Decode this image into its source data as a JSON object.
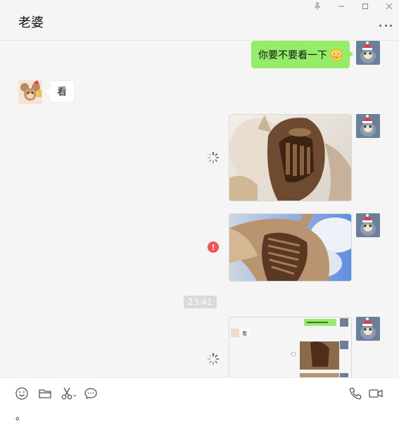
{
  "window": {
    "title": "老婆",
    "controls": [
      "pin-icon",
      "minimize-icon",
      "maximize-icon",
      "close-icon"
    ]
  },
  "messages": [
    {
      "sender": "me",
      "type": "text",
      "text": "你要不要看一下",
      "emoji": "flushed-face-icon"
    },
    {
      "sender": "contact",
      "type": "text",
      "text": "看"
    },
    {
      "sender": "me",
      "type": "image",
      "status": "sending"
    },
    {
      "sender": "me",
      "type": "image",
      "status": "failed"
    },
    {
      "sender": "system",
      "type": "timestamp",
      "text": "23:41"
    },
    {
      "sender": "me",
      "type": "image-screenshot",
      "status": "sending",
      "preview_text": "看"
    }
  ],
  "colors": {
    "my_bubble": "#95ec69",
    "their_bubble": "#ffffff",
    "error": "#fa5151",
    "background": "#f5f5f5"
  },
  "toolbar": {
    "left_tools": [
      "emoji-icon",
      "folder-icon",
      "scissors-icon",
      "chat-history-icon"
    ],
    "right_tools": [
      "phone-icon",
      "video-call-icon"
    ]
  },
  "input": {
    "value": "。"
  }
}
